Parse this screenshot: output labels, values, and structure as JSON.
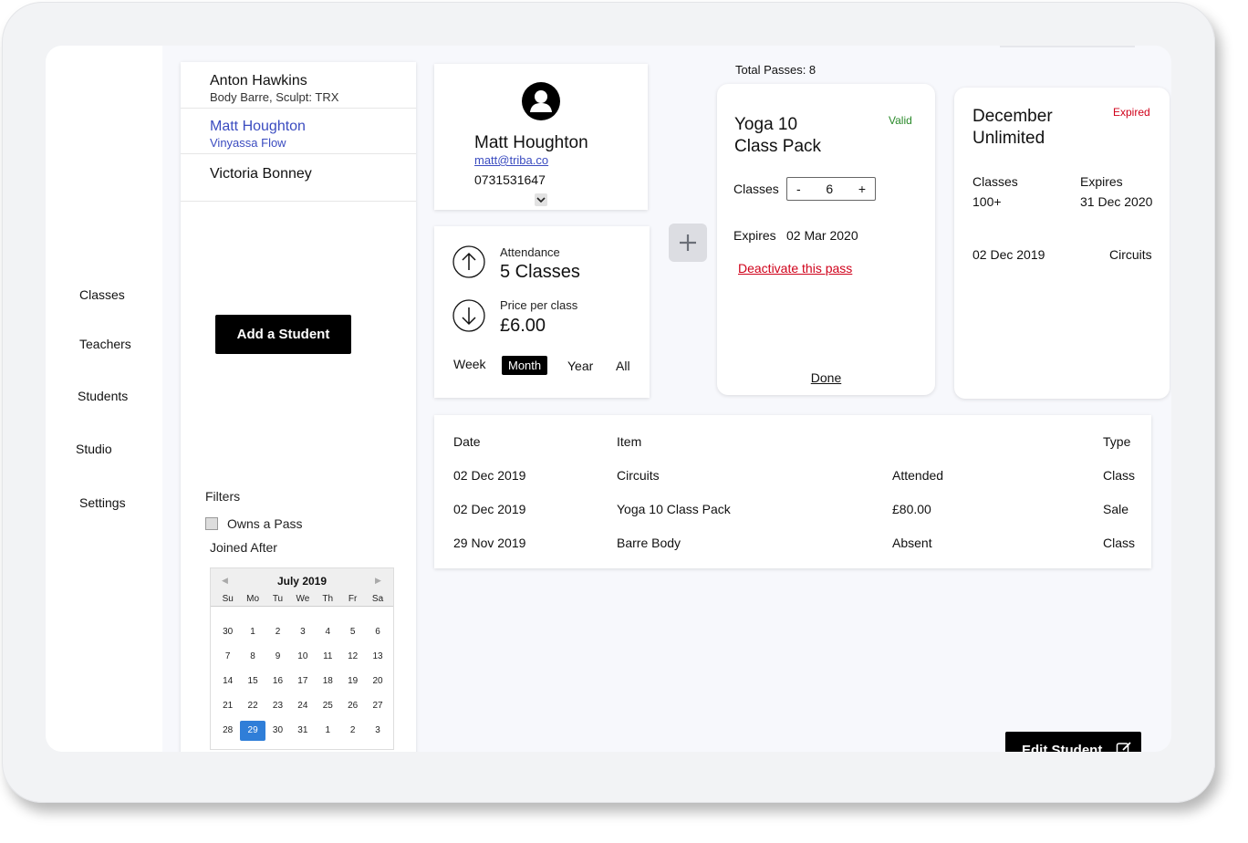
{
  "nav": {
    "items": [
      "Classes",
      "Teachers",
      "Students",
      "Studio",
      "Settings"
    ]
  },
  "students": [
    {
      "name": "Anton Hawkins",
      "classes": "Body Barre, Sculpt: TRX"
    },
    {
      "name": "Matt Houghton",
      "classes": "Vinyassa Flow"
    },
    {
      "name": "Victoria Bonney",
      "classes": ""
    }
  ],
  "add_student_label": "Add a Student",
  "filters": {
    "title": "Filters",
    "owns_pass": "Owns a Pass",
    "joined_after": "Joined After"
  },
  "calendar": {
    "month": "July 2019",
    "days_of_week": [
      "Su",
      "Mo",
      "Tu",
      "We",
      "Th",
      "Fr",
      "Sa"
    ],
    "weeks": [
      [
        "30",
        "1",
        "2",
        "3",
        "4",
        "5",
        "6"
      ],
      [
        "7",
        "8",
        "9",
        "10",
        "11",
        "12",
        "13"
      ],
      [
        "14",
        "15",
        "16",
        "17",
        "18",
        "19",
        "20"
      ],
      [
        "21",
        "22",
        "23",
        "24",
        "25",
        "26",
        "27"
      ],
      [
        "28",
        "29",
        "30",
        "31",
        "1",
        "2",
        "3"
      ]
    ],
    "selected": "29"
  },
  "profile": {
    "name": "Matt Houghton",
    "email": "matt@triba.co",
    "phone": "0731531647"
  },
  "stats": {
    "attendance_label": "Attendance",
    "attendance_value": "5 Classes",
    "price_label": "Price per class",
    "price_value": "£6.00",
    "periods": [
      "Week",
      "Month",
      "Year",
      "All"
    ],
    "active_period": "Month"
  },
  "passes": {
    "total": "Total Passes: 8",
    "current": {
      "title_line1": "Yoga 10",
      "title_line2": "Class Pack",
      "status": "Valid",
      "classes_label": "Classes",
      "classes_value": "6",
      "minus": "-",
      "plus": "+",
      "expires_label": "Expires",
      "expires_value": "02 Mar 2020",
      "deactivate": "Deactivate this pass",
      "done": "Done"
    },
    "expired": {
      "title_line1": "December",
      "title_line2": "Unlimited",
      "status": "Expired",
      "classes_label": "Classes",
      "classes_value": "100+",
      "expires_label": "Expires",
      "expires_value": "31 Dec 2020",
      "last_date": "02 Dec 2019",
      "last_class": "Circuits"
    }
  },
  "history": {
    "headers": {
      "date": "Date",
      "item": "Item",
      "type": "Type"
    },
    "rows": [
      {
        "date": "02 Dec 2019",
        "item": "Circuits",
        "detail": "Attended",
        "type": "Class"
      },
      {
        "date": "02 Dec 2019",
        "item": "Yoga 10 Class Pack",
        "detail": "£80.00",
        "type": "Sale"
      },
      {
        "date": "29 Nov 2019",
        "item": "Barre Body",
        "detail": "Absent",
        "type": "Class"
      }
    ]
  },
  "edit_student_label": "Edit Student",
  "colors": {
    "link": "#3b4cc0",
    "valid": "#2a8a2a",
    "expired": "#d0021b",
    "selected_day": "#2f7ed8"
  }
}
